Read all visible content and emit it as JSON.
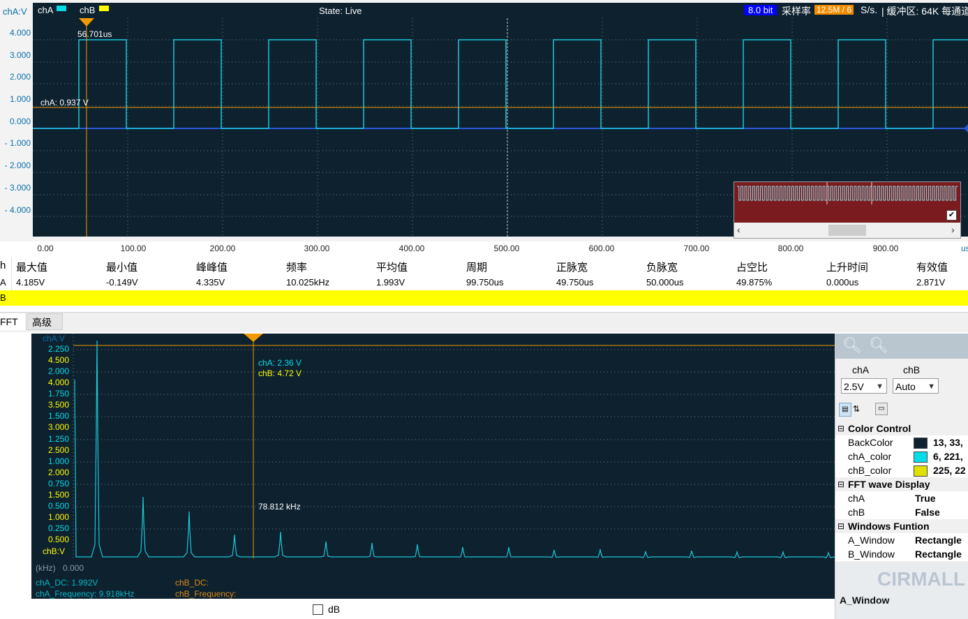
{
  "scope": {
    "header": {
      "axis_label": "chA:V",
      "legend": [
        {
          "name": "chA",
          "color": "#06dde8"
        },
        {
          "name": "chB",
          "color": "#ffff00"
        }
      ],
      "state": "State: Live",
      "bit_depth": "8.0 bit",
      "sample_rate_label": "采样率",
      "sample_rate_value": "12.5M / 6",
      "sample_rate_unit": "S/s.",
      "buffer_text": "| 缓冲区: 64K 每通道"
    },
    "cursor_time": "56.701us",
    "level_label": "chA: 0.937 V",
    "y_ticks": [
      "4.000",
      "3.000",
      "2.000",
      "1.000",
      "0.000",
      "- 1.000",
      "- 2.000",
      "- 3.000",
      "- 4.000"
    ],
    "x_ticks": [
      "0.00",
      "100.00",
      "200.00",
      "300.00",
      "400.00",
      "500.00",
      "600.00",
      "700.00",
      "800.00",
      "900.00"
    ],
    "x_unit": "us",
    "overview_checked": true
  },
  "measurements": {
    "row_header": "h",
    "row_channel": "A",
    "columns": [
      {
        "label": "最大值",
        "value": "4.185V"
      },
      {
        "label": "最小值",
        "value": "-0.149V"
      },
      {
        "label": "峰峰值",
        "value": "4.335V"
      },
      {
        "label": "频率",
        "value": "10.025kHz"
      },
      {
        "label": "平均值",
        "value": "1.993V"
      },
      {
        "label": "周期",
        "value": "99.750us"
      },
      {
        "label": "正脉宽",
        "value": "49.750us"
      },
      {
        "label": "负脉宽",
        "value": "50.000us"
      },
      {
        "label": "占空比",
        "value": "49.875%"
      },
      {
        "label": "上升时间",
        "value": "0.000us"
      },
      {
        "label": "有效值",
        "value": "2.871V"
      }
    ],
    "chb_row": "B"
  },
  "tabs": [
    {
      "label": "FFT",
      "selected": true
    },
    {
      "label": "高级",
      "selected": false
    }
  ],
  "fft": {
    "cha_label": "chA:V",
    "chb_label": "chB:V",
    "ticks": [
      {
        "text": "2.250",
        "color": "#06dde8"
      },
      {
        "text": "4.500",
        "color": "#ffff00"
      },
      {
        "text": "2.000",
        "color": "#06dde8"
      },
      {
        "text": "4.000",
        "color": "#ffff00"
      },
      {
        "text": "1.750",
        "color": "#06dde8"
      },
      {
        "text": "3.500",
        "color": "#ffff00"
      },
      {
        "text": "1.500",
        "color": "#06dde8"
      },
      {
        "text": "3.000",
        "color": "#ffff00"
      },
      {
        "text": "1.250",
        "color": "#06dde8"
      },
      {
        "text": "2.500",
        "color": "#ffff00"
      },
      {
        "text": "1.000",
        "color": "#06dde8"
      },
      {
        "text": "2.000",
        "color": "#ffff00"
      },
      {
        "text": "0.750",
        "color": "#06dde8"
      },
      {
        "text": "1.500",
        "color": "#ffff00"
      },
      {
        "text": "0.500",
        "color": "#06dde8"
      },
      {
        "text": "1.000",
        "color": "#ffff00"
      },
      {
        "text": "0.250",
        "color": "#06dde8"
      },
      {
        "text": "0.500",
        "color": "#ffff00"
      }
    ],
    "x_label": "(kHz)",
    "x_zero": "0.000",
    "cursor_cha": "chA: 2.36 V",
    "cursor_chb": "chB: 4.72 V",
    "cursor_freq": "78.812 kHz",
    "cha_dc": "chA_DC: 1.992V",
    "cha_freq": "chA_Frequency: 9.918kHz",
    "chb_dc": "chB_DC:",
    "chb_freq": "chB_Frequency:",
    "db_label": "dB",
    "db_checked": false
  },
  "side": {
    "cha_label": "chA",
    "chb_label": "chB",
    "cha_select": "2.5V",
    "chb_select": "Auto",
    "props": [
      {
        "kind": "cat",
        "name": "Color Control",
        "value": ""
      },
      {
        "kind": "color",
        "name": "BackColor",
        "value": "13, 33,",
        "swatch": "#0d212f"
      },
      {
        "kind": "color",
        "name": "chA_color",
        "value": "6, 221,",
        "swatch": "#06dde8"
      },
      {
        "kind": "color",
        "name": "chB_color",
        "value": "225, 22",
        "swatch": "#e1e100"
      },
      {
        "kind": "cat",
        "name": "FFT wave Display",
        "value": ""
      },
      {
        "kind": "prop",
        "name": "chA",
        "value": "True"
      },
      {
        "kind": "prop",
        "name": "chB",
        "value": "False"
      },
      {
        "kind": "cat",
        "name": "Windows Funtion",
        "value": ""
      },
      {
        "kind": "prop",
        "name": "A_Window",
        "value": "Rectangle"
      },
      {
        "kind": "prop",
        "name": "B_Window",
        "value": "Rectangle"
      }
    ],
    "bottom_label": "A_Window",
    "watermark": "CIRMALL"
  }
}
